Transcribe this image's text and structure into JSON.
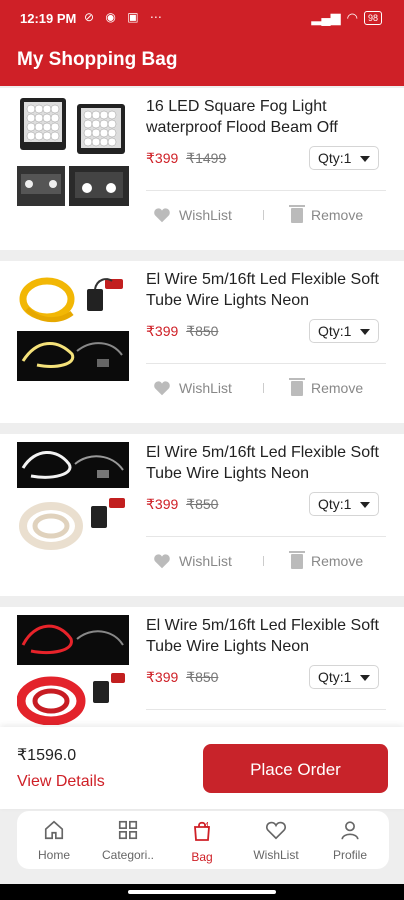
{
  "status": {
    "time": "12:19 PM",
    "battery": "98"
  },
  "header": {
    "title": "My Shopping Bag"
  },
  "items": [
    {
      "name": "16 LED Square Fog Light waterproof Flood Beam Off",
      "price": "₹399",
      "mrp": "₹1499",
      "qty": "Qty:1"
    },
    {
      "name": "El Wire 5m/16ft Led Flexible Soft Tube Wire Lights Neon",
      "price": "₹399",
      "mrp": "₹850",
      "qty": "Qty:1"
    },
    {
      "name": "El Wire 5m/16ft Led Flexible Soft Tube Wire Lights Neon",
      "price": "₹399",
      "mrp": "₹850",
      "qty": "Qty:1"
    },
    {
      "name": "El Wire 5m/16ft Led Flexible Soft Tube Wire Lights Neon",
      "price": "₹399",
      "mrp": "₹850",
      "qty": "Qty:1"
    }
  ],
  "actions": {
    "wishlist": "WishList",
    "remove": "Remove"
  },
  "summary": {
    "total": "₹1596.0",
    "view_details": "View Details",
    "place_order": "Place Order"
  },
  "nav": [
    {
      "label": "Home",
      "icon": "home-icon"
    },
    {
      "label": "Categori..",
      "icon": "grid-icon"
    },
    {
      "label": "Bag",
      "icon": "bag-icon"
    },
    {
      "label": "WishList",
      "icon": "heart-icon"
    },
    {
      "label": "Profile",
      "icon": "user-icon"
    }
  ],
  "colors": {
    "brand": "#cf2027",
    "price": "#cf2027"
  }
}
